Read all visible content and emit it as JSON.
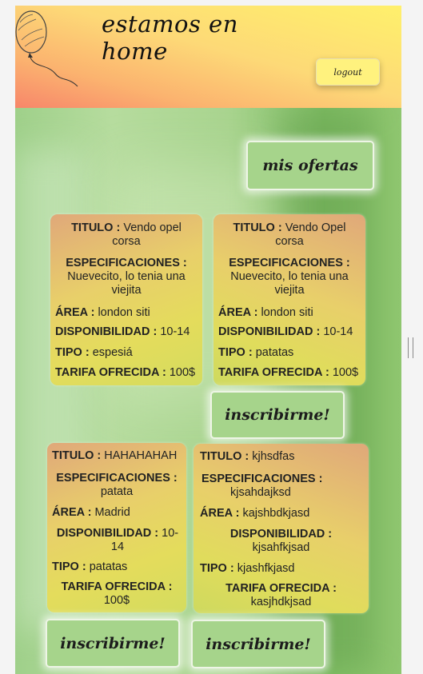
{
  "header": {
    "title": "estamos en home",
    "logout_label": "logout"
  },
  "my_offers_label": "mis ofertas",
  "subscribe_label": "inscribirme!",
  "labels": {
    "titulo": "TITULO :",
    "especificaciones": "ESPECIFICACIONES :",
    "area": "ÁREA :",
    "disponibilidad": "DISPONIBILIDAD :",
    "tipo": "TIPO :",
    "tarifa": "TARIFA OFRECIDA :"
  },
  "offers": [
    {
      "titulo": "Vendo opel corsa",
      "especificaciones": "Nuevecito, lo tenia una viejita",
      "area": "london siti",
      "disponibilidad": "10-14",
      "tipo": "espesiá",
      "tarifa": "100$"
    },
    {
      "titulo": "Vendo Opel corsa",
      "especificaciones": "Nuevecito, lo tenia una viejita",
      "area": "london siti",
      "disponibilidad": "10-14",
      "tipo": "patatas",
      "tarifa": "100$"
    },
    {
      "titulo": "HAHAHAHAH",
      "especificaciones": "patata",
      "area": "Madrid",
      "disponibilidad": "10-14",
      "tipo": "patatas",
      "tarifa": "100$"
    },
    {
      "titulo": "kjhsdfas",
      "especificaciones": "kjsahdajksd",
      "area": "kajshbdkjasd",
      "disponibilidad": "kjsahfkjsad",
      "tipo": "kjashfkjasd",
      "tarifa": "kasjhdkjsad"
    }
  ]
}
